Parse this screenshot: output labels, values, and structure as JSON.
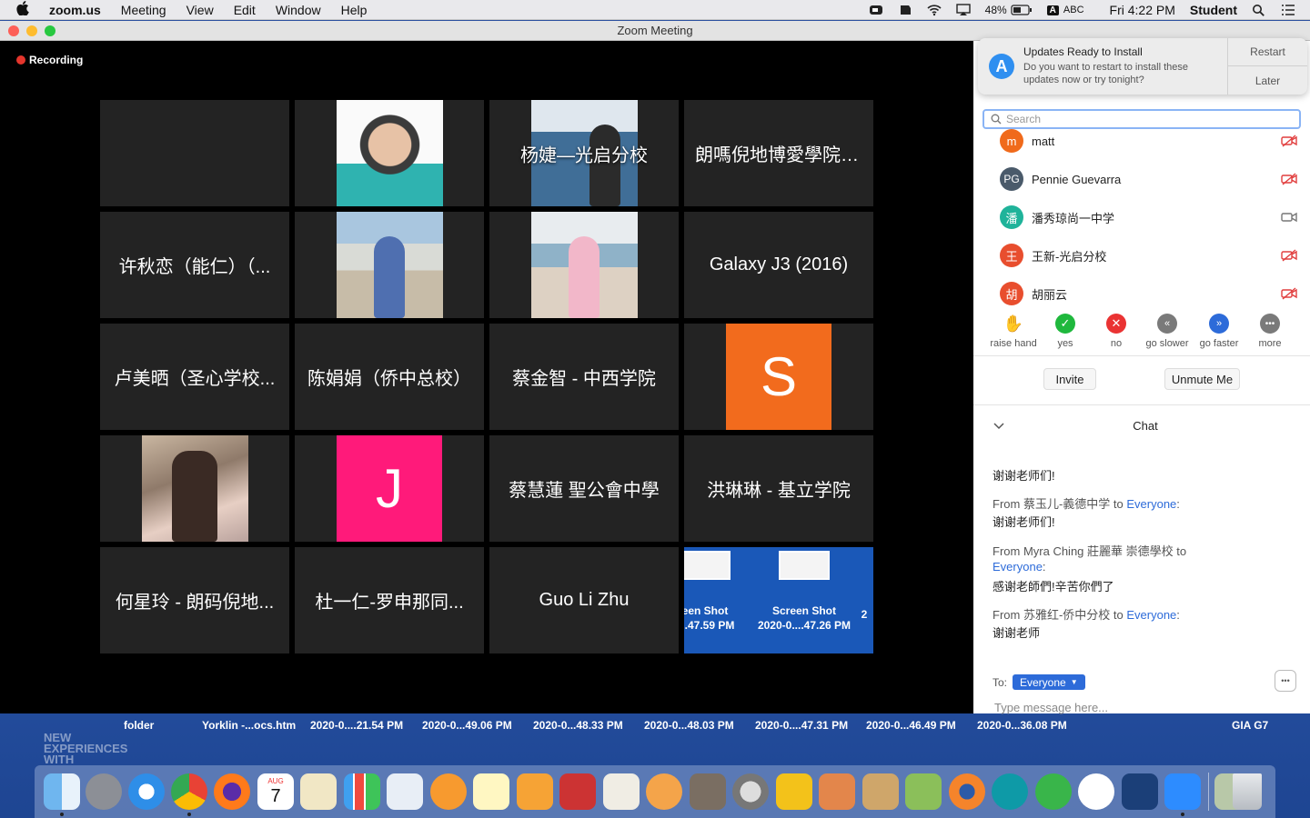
{
  "menubar": {
    "app": "zoom.us",
    "items": [
      "Meeting",
      "View",
      "Edit",
      "Window",
      "Help"
    ],
    "battery": "48%",
    "input": "ABC",
    "clock": "Fri 4:22 PM",
    "user": "Student"
  },
  "window": {
    "title": "Zoom Meeting"
  },
  "recording": "Recording",
  "tiles": {
    "t3": "杨婕—光启分校",
    "t4": "朗嗎倪地博愛學院學校",
    "t5": "许秋恋（能仁）（...",
    "t8": "Galaxy J3 (2016)",
    "t9": "卢美晒（圣心学校...",
    "t10": "陈娟娟（侨中总校）",
    "t11": "蔡金智 - 中西学院",
    "t12_avatar": "S",
    "t14_avatar": "J",
    "t15": "蔡慧蓮 聖公會中學",
    "t16": "洪琳琳 - 基立学院",
    "t17": "何星玲 - 朗码倪地...",
    "t18": "杜一仁-罗申那同...",
    "t19": "Guo Li Zhu",
    "share_a": "een Shot",
    "share_a2": "....47.59 PM",
    "share_b": "Screen Shot",
    "share_b2": "2020-0....47.26 PM",
    "share_c": "2"
  },
  "notification": {
    "title": "Updates Ready to Install",
    "body": "Do you want to restart to install these updates now or try tonight?",
    "restart": "Restart",
    "later": "Later"
  },
  "search_placeholder": "Search",
  "participants": [
    {
      "initial": "m",
      "name": "matt",
      "color": "#f06a1b"
    },
    {
      "initial": "PG",
      "name": "Pennie Guevarra",
      "color": "#4a5a6a"
    },
    {
      "initial": "潘",
      "name": "潘秀琼尚一中学",
      "color": "#1fb39a"
    },
    {
      "initial": "王",
      "name": "王新-光启分校",
      "color": "#e84e2e"
    },
    {
      "initial": "胡",
      "name": "胡丽云",
      "color": "#e84e2e"
    }
  ],
  "reactions": {
    "raise": "raise hand",
    "yes": "yes",
    "no": "no",
    "slower": "go slower",
    "faster": "go faster",
    "more": "more"
  },
  "buttons": {
    "invite": "Invite",
    "unmute": "Unmute Me"
  },
  "chat": {
    "title": "Chat",
    "m0": "谢谢老师们!",
    "m1_from": "From 蔡玉儿-義德中学 to",
    "m1_to": "Everyone",
    "m1_text": "谢谢老师们!",
    "m2_from": "From Myra Ching 莊麗華 崇德學校 to",
    "m2_to": "Everyone",
    "m2_text": "感谢老師們!辛苦你們了",
    "m3_from": "From 苏雅红-侨中分校 to",
    "m3_to": "Everyone",
    "m3_text": "谢谢老师",
    "to_label": "To:",
    "to_value": "Everyone",
    "input_placeholder": "Type message here..."
  },
  "desktop": {
    "f0": "folder",
    "f1": "Yorklin -...ocs.htm",
    "f2": "2020-0....21.54 PM",
    "f3": "2020-0...49.06 PM",
    "f4": "2020-0...48.33 PM",
    "f5": "2020-0...48.03 PM",
    "f6": "2020-0....47.31 PM",
    "f7": "2020-0...46.49 PM",
    "f8": "2020-0...36.08 PM",
    "f9": "GIA G7",
    "bg1": "NEW",
    "bg2": "EXPERIENCES",
    "bg3": "WITH",
    "dock_calendar_month": "AUG",
    "dock_calendar_day": "7"
  }
}
